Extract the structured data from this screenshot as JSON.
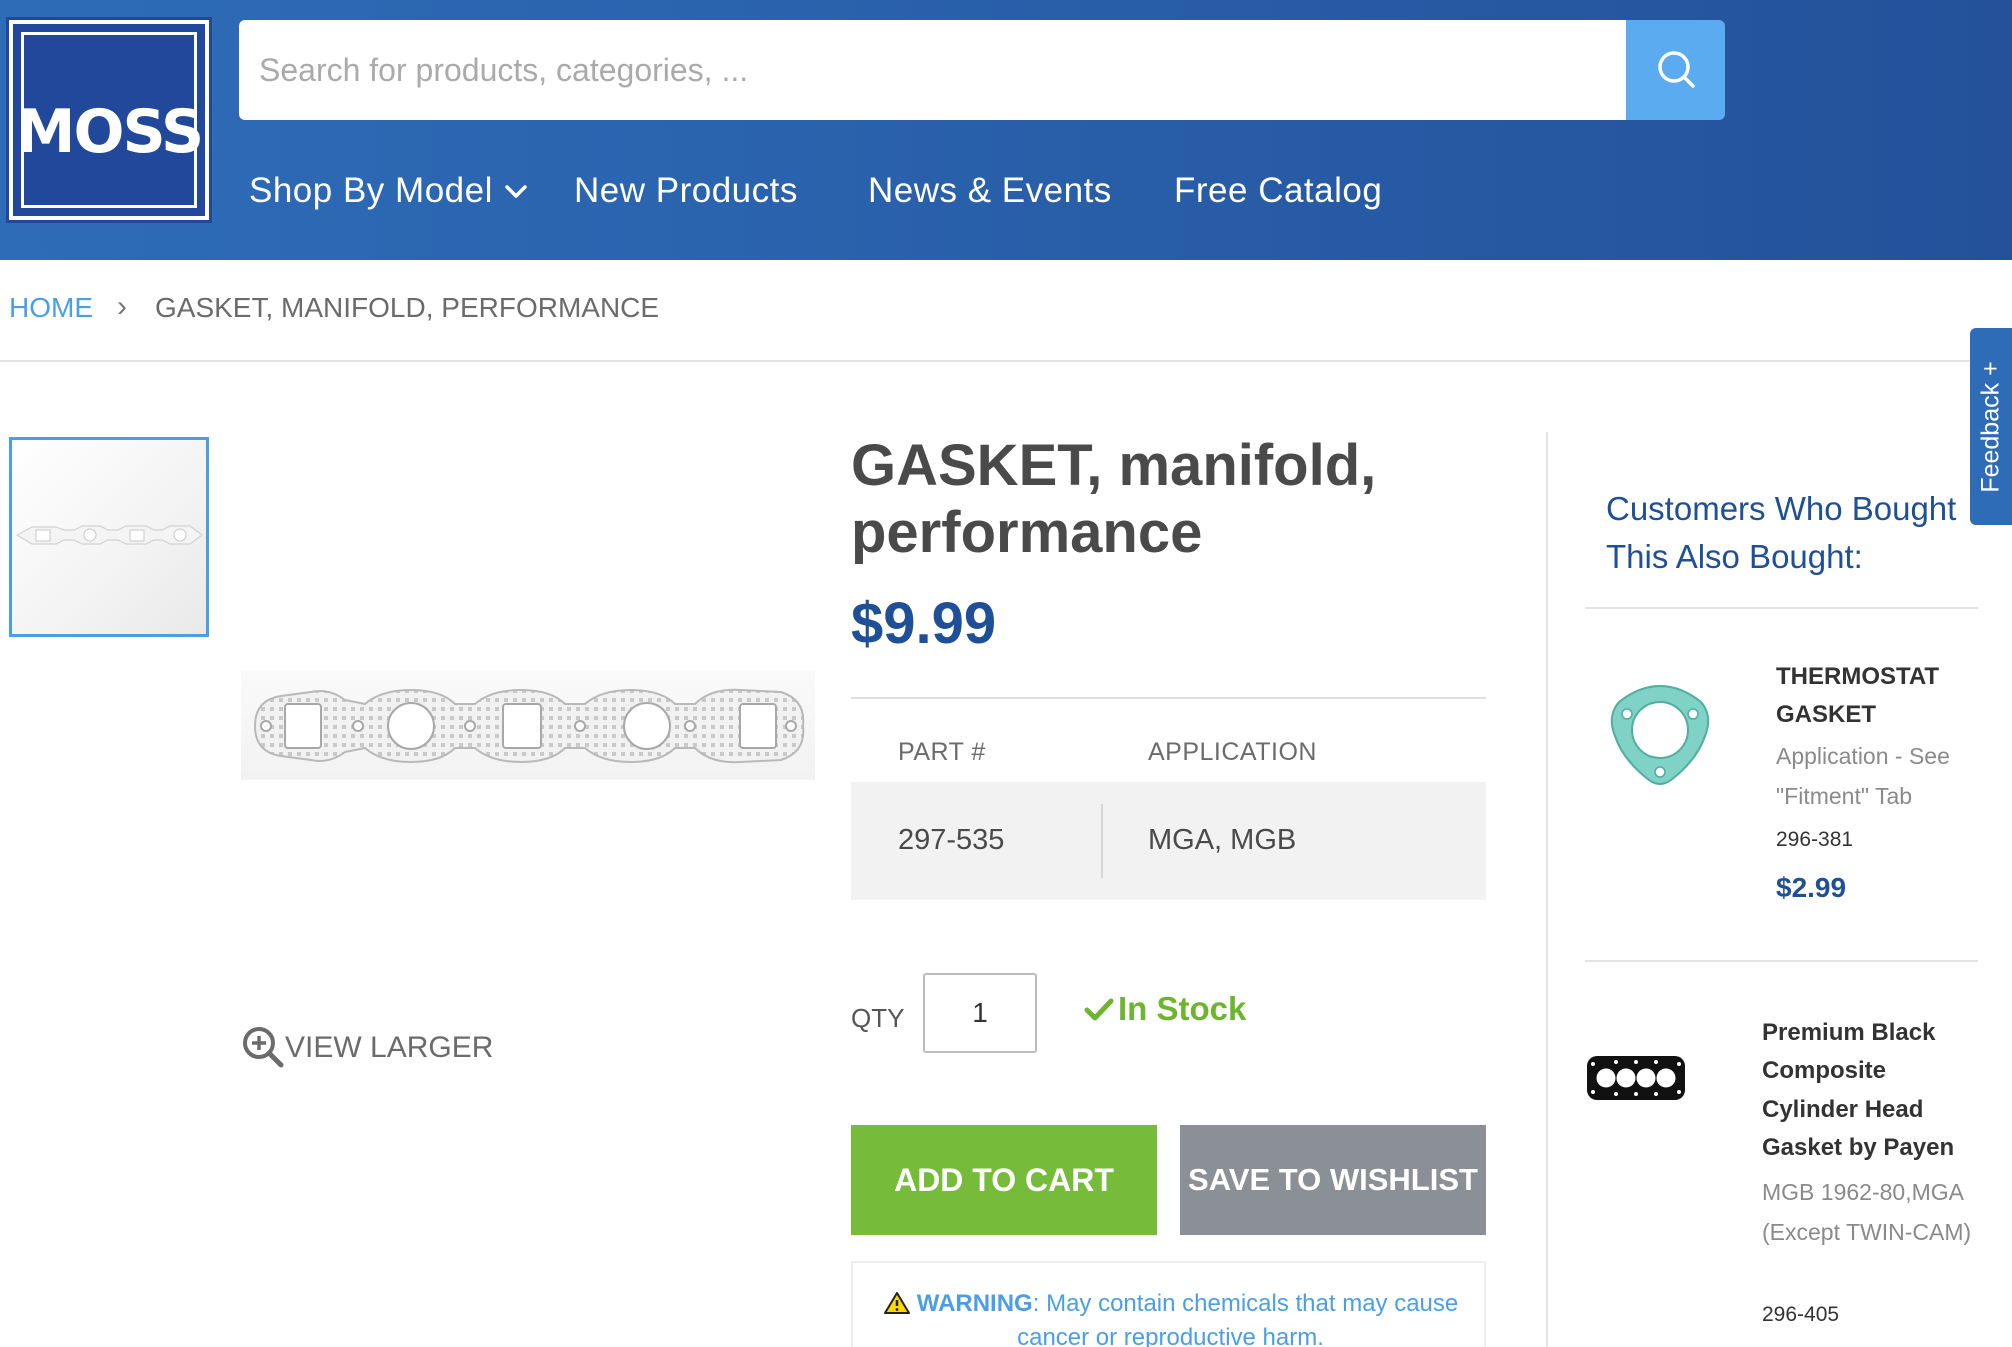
{
  "header": {
    "logo_text": "MOSS",
    "search": {
      "placeholder": "Search for products, categories, ..."
    },
    "nav": {
      "shop_by_model": "Shop By Model",
      "new_products": "New Products",
      "news_events": "News & Events",
      "free_catalog": "Free Catalog"
    }
  },
  "breadcrumb": {
    "home": "HOME",
    "separator": "›",
    "current": "GASKET, MANIFOLD, PERFORMANCE"
  },
  "gallery": {
    "view_larger": "VIEW LARGER"
  },
  "product": {
    "title": "GASKET, manifold, performance",
    "price": "$9.99",
    "table": {
      "part_header": "PART #",
      "application_header": "APPLICATION",
      "part_number": "297-535",
      "application": "MGA, MGB"
    },
    "qty_label": "QTY",
    "qty_value": "1",
    "stock_status": "In Stock",
    "add_to_cart": "ADD TO CART",
    "save_to_wishlist": "SAVE TO WISHLIST",
    "warning_label": "WARNING",
    "warning_text": ": May contain chemicals that may cause cancer or reproductive harm."
  },
  "sidebar": {
    "title": "Customers Who Bought This Also Bought:",
    "items": [
      {
        "name": "THERMOSTAT GASKET",
        "application": "Application - See \"Fitment\" Tab",
        "part_number": "296-381",
        "price": "$2.99"
      },
      {
        "name": "Premium Black Composite Cylinder Head Gasket by Payen",
        "application": "MGB 1962-80,MGA (Except TWIN-CAM)",
        "part_number": "296-405"
      }
    ]
  },
  "feedback": {
    "label": "Feedback +"
  },
  "colors": {
    "header_blue": "#2a62ad",
    "search_button": "#5aabf0",
    "price_blue": "#1f4f97",
    "link_blue": "#4a9ee8",
    "add_to_cart_green": "#76bc3a",
    "wishlist_gray": "#8b8f96",
    "in_stock_green": "#6cb52f"
  },
  "icons": [
    "search-icon",
    "chevron-down-icon",
    "zoom-in-icon",
    "checkmark-icon",
    "warning-icon"
  ]
}
